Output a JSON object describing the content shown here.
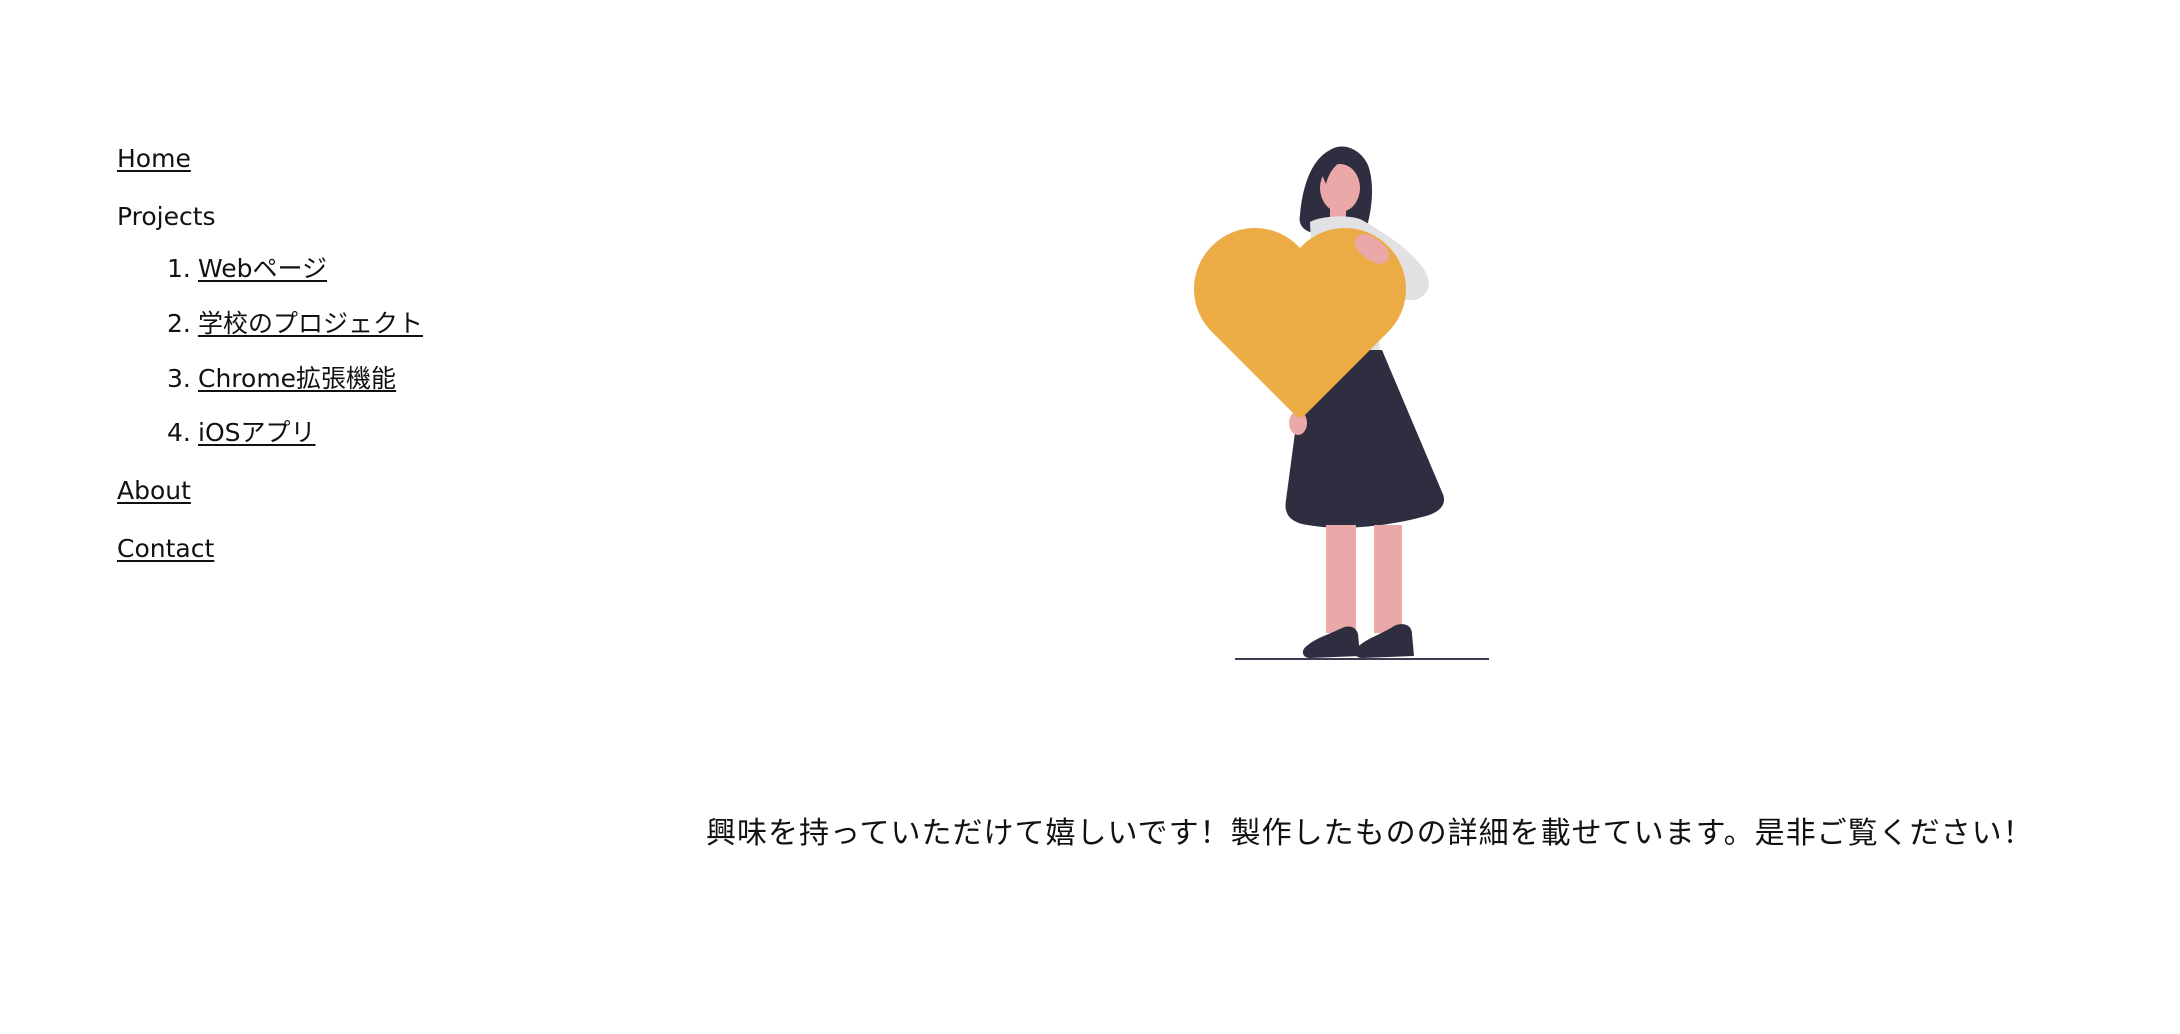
{
  "nav": {
    "home_label": "Home",
    "projects_label": "Projects",
    "projects": [
      {
        "number": "1.",
        "label": "Webページ"
      },
      {
        "number": "2.",
        "label": "学校のプロジェクト"
      },
      {
        "number": "3.",
        "label": "Chrome拡張機能"
      },
      {
        "number": "4.",
        "label": "iOSアプリ"
      }
    ],
    "about_label": "About",
    "contact_label": "Contact"
  },
  "hero": {
    "illustration": "woman-holding-heart-illustration",
    "colors": {
      "heart": "#ECAB45",
      "hair_and_skirt": "#2F2E41",
      "skin": "#EBA8A8",
      "shirt": "#E2E2E4",
      "ground_line": "#3F3D56"
    }
  },
  "main": {
    "message": "興味を持っていただけて嬉しいです！製作したものの詳細を載せています。是非ご覧ください！"
  }
}
